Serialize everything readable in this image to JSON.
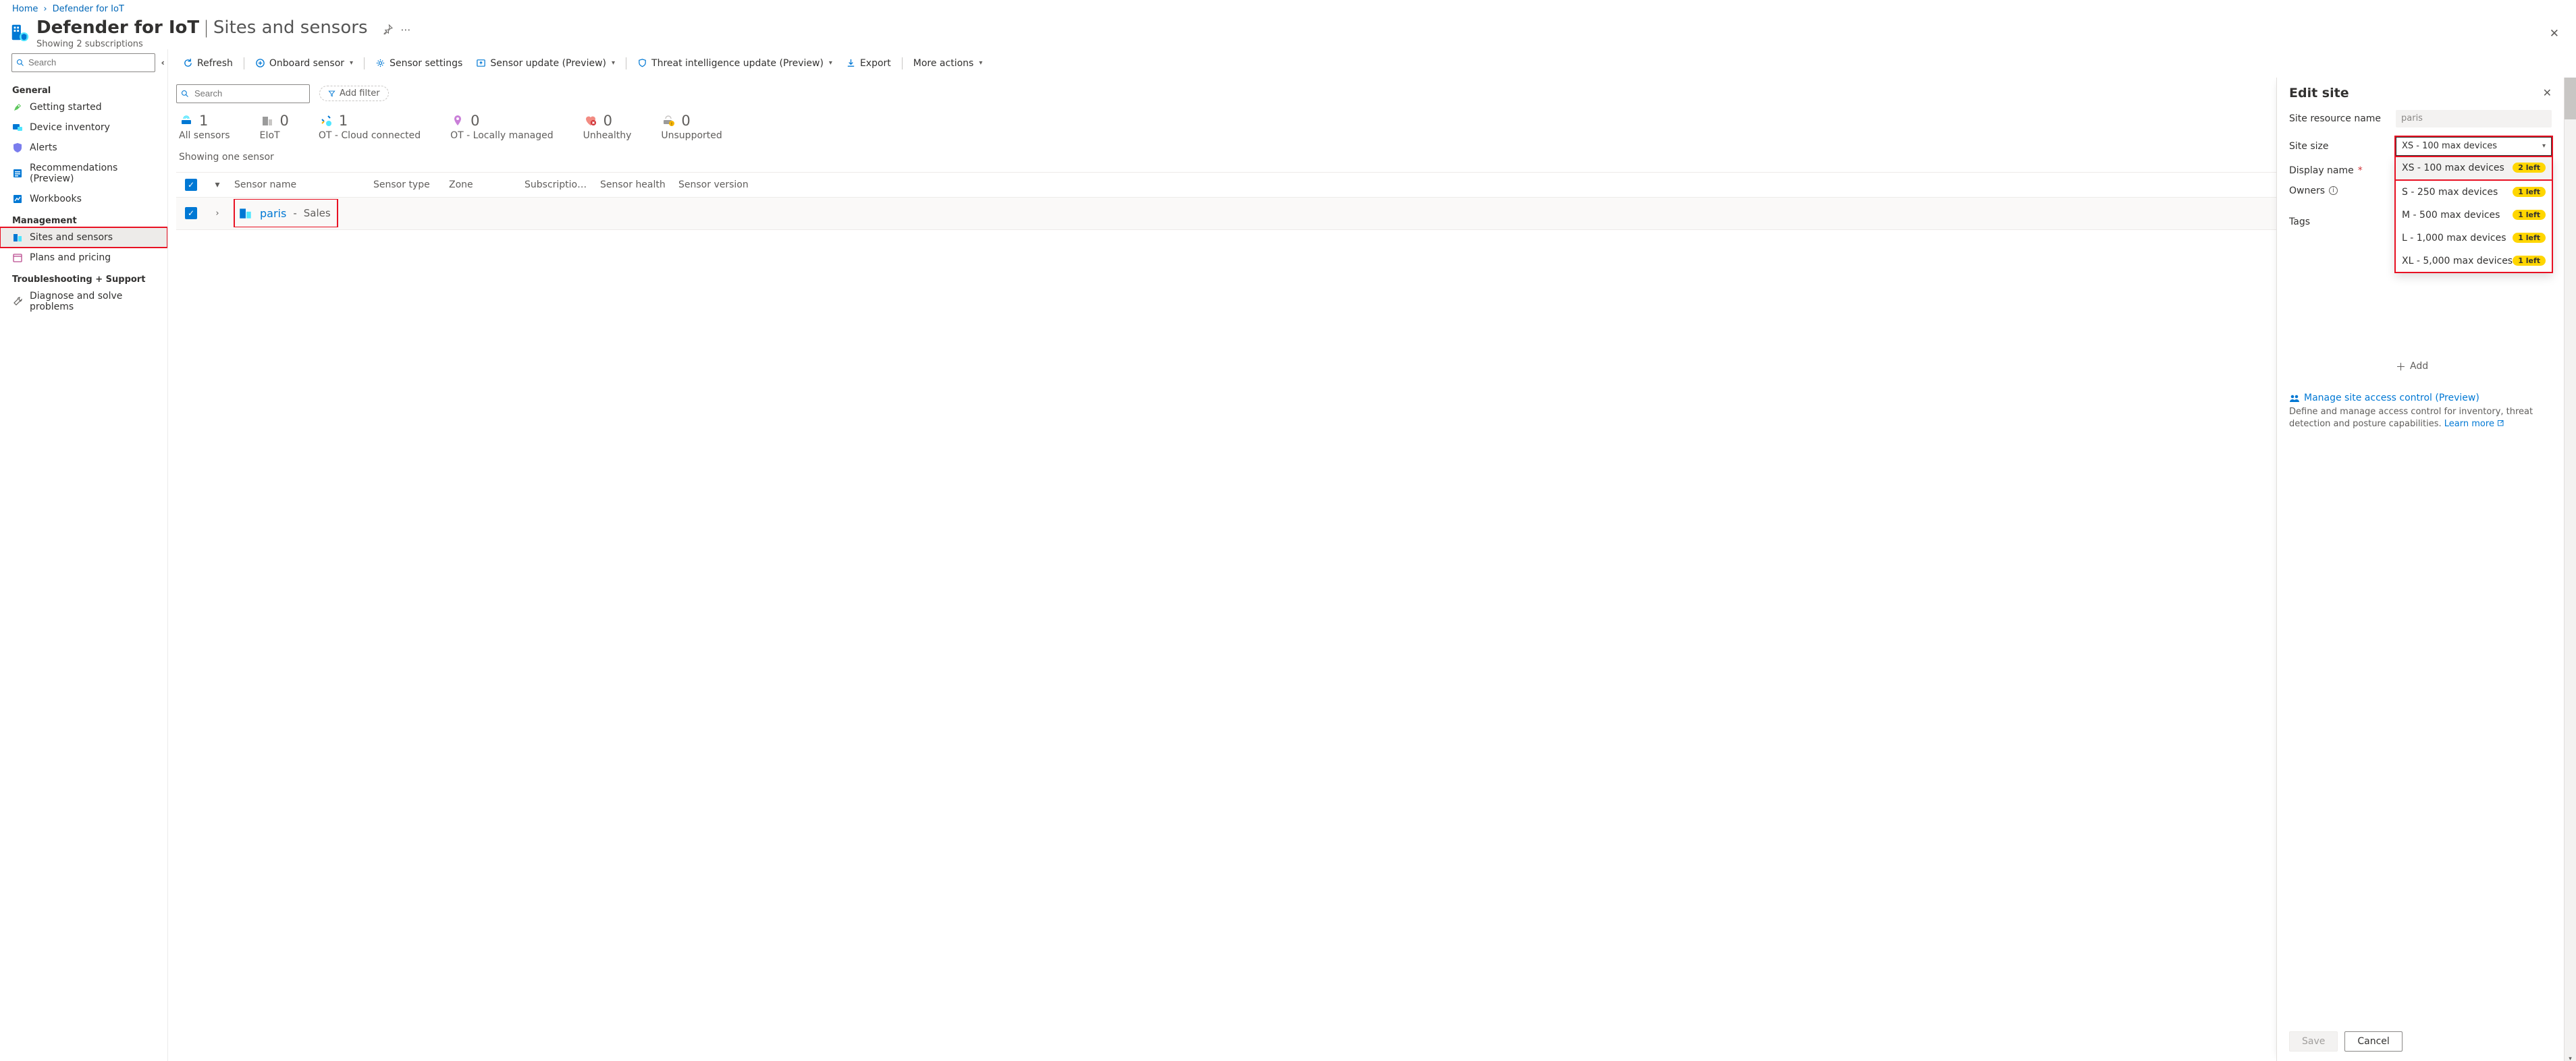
{
  "breadcrumb": {
    "home": "Home",
    "crumb1": "Defender for IoT"
  },
  "header": {
    "primary": "Defender for IoT",
    "secondary": "Sites and sensors",
    "subtitle": "Showing 2 subscriptions"
  },
  "sidebar": {
    "search_placeholder": "Search",
    "sections": {
      "general": "General",
      "management": "Management",
      "troubleshoot": "Troubleshooting + Support"
    },
    "items": {
      "getting_started": "Getting started",
      "device_inventory": "Device inventory",
      "alerts": "Alerts",
      "recommendations": "Recommendations (Preview)",
      "workbooks": "Workbooks",
      "sites_sensors": "Sites and sensors",
      "plans_pricing": "Plans and pricing",
      "diagnose": "Diagnose and solve problems"
    }
  },
  "toolbar": {
    "refresh": "Refresh",
    "onboard": "Onboard sensor",
    "sensor_settings": "Sensor settings",
    "sensor_update": "Sensor update (Preview)",
    "threat": "Threat intelligence update (Preview)",
    "export": "Export",
    "more": "More actions"
  },
  "filters": {
    "search_placeholder": "Search",
    "add_filter": "Add filter"
  },
  "stats": {
    "all_sensors": {
      "num": "1",
      "label": "All sensors"
    },
    "eiot": {
      "num": "0",
      "label": "EIoT"
    },
    "ot_cloud": {
      "num": "1",
      "label": "OT - Cloud connected"
    },
    "ot_local": {
      "num": "0",
      "label": "OT - Locally managed"
    },
    "unhealthy": {
      "num": "0",
      "label": "Unhealthy"
    },
    "unsupported": {
      "num": "0",
      "label": "Unsupported"
    }
  },
  "showing_line": "Showing one sensor",
  "grid": {
    "columns": {
      "name": "Sensor name",
      "type": "Sensor type",
      "zone": "Zone",
      "sub": "Subscription ...",
      "health": "Sensor health",
      "version": "Sensor version"
    },
    "row0": {
      "site": "paris",
      "dash": "-",
      "detail": "Sales"
    }
  },
  "panel": {
    "title": "Edit site",
    "resource_label": "Site resource name",
    "resource_value": "paris",
    "size_label": "Site size",
    "size_value": "XS - 100 max devices",
    "display_label": "Display name",
    "owners_label": "Owners",
    "tags_label": "Tags",
    "add": "Add",
    "access_link": "Manage site access control (Preview)",
    "access_desc": "Define and manage access control for inventory, threat detection and posture capabilities.  ",
    "learn_more": "Learn more",
    "save": "Save",
    "cancel": "Cancel",
    "options": {
      "xs": {
        "label": "XS - 100 max devices",
        "left": "2 left"
      },
      "s": {
        "label": "S - 250 max devices",
        "left": "1 left"
      },
      "m": {
        "label": "M - 500 max devices",
        "left": "1 left"
      },
      "l": {
        "label": "L - 1,000 max devices",
        "left": "1 left"
      },
      "xl": {
        "label": "XL - 5,000 max devices",
        "left": "1 left"
      }
    }
  }
}
